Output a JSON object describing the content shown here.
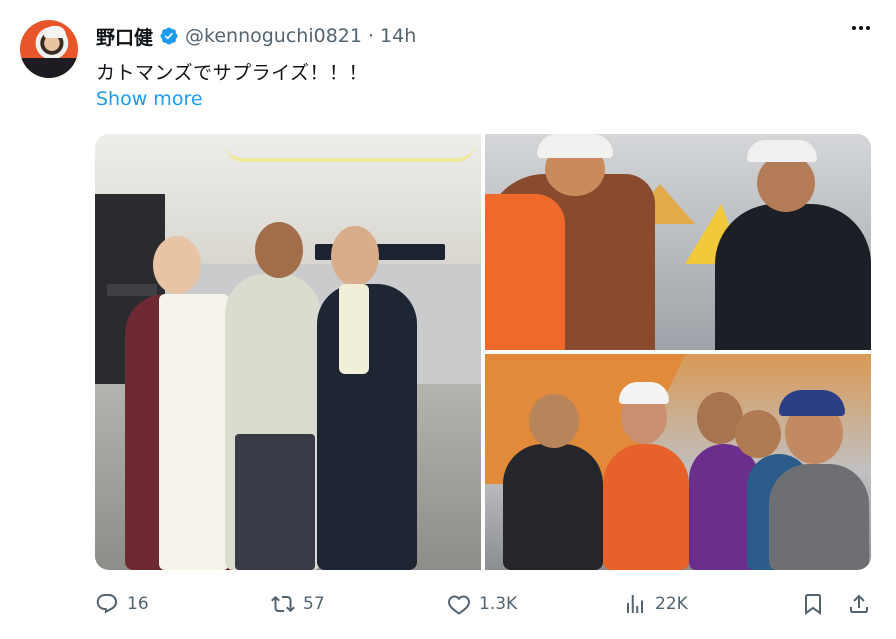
{
  "author": {
    "name": "野口健",
    "handle": "@kennoguchi0821",
    "separator": "·",
    "time": "14h"
  },
  "tweet": {
    "text": "カトマンズでサプライズ！！！",
    "show_more": "Show more"
  },
  "actions": {
    "replies": "16",
    "reposts": "57",
    "likes": "1.3K",
    "views": "22K"
  },
  "colors": {
    "accent": "#1d9bf0",
    "muted": "#536471",
    "text": "#0f1419"
  }
}
